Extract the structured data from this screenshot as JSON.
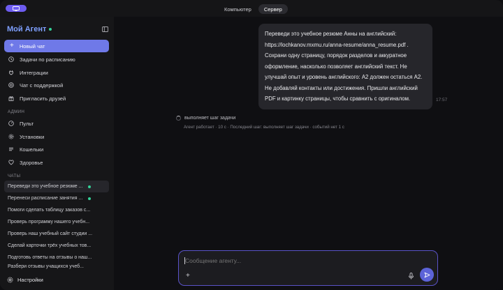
{
  "topbar": {
    "modes": [
      "Компьютер",
      "Сервер"
    ],
    "active_mode": "Сервер"
  },
  "sidebar": {
    "brand": "Мой Агент",
    "new_chat": "Новый чат",
    "nav": [
      {
        "label": "Задачи по расписанию",
        "icon": "clock-icon"
      },
      {
        "label": "Интеграции",
        "icon": "plug-icon"
      },
      {
        "label": "Чат с поддержкой",
        "icon": "support-icon"
      },
      {
        "label": "Пригласить друзей",
        "icon": "gift-icon"
      }
    ],
    "admin_label": "АДМИН",
    "admin": [
      {
        "label": "Пульт",
        "icon": "dashboard-icon"
      },
      {
        "label": "Установки",
        "icon": "gear-icon"
      },
      {
        "label": "Кошельки",
        "icon": "wallet-icon"
      },
      {
        "label": "Здоровье",
        "icon": "heart-icon"
      }
    ],
    "chats_label": "ЧАТЫ",
    "chats": [
      {
        "label": "Переведи это учебное резюме ...",
        "dot": true,
        "active": true
      },
      {
        "label": "Перенеси расписание занятия ...",
        "dot": true,
        "active": false
      },
      {
        "label": "Помоги сделать таблицу заказов с...",
        "dot": false,
        "active": false
      },
      {
        "label": "Проверь программу нашего учебн...",
        "dot": false,
        "active": false
      },
      {
        "label": "Проверь наш учебный сайт студии ...",
        "dot": false,
        "active": false
      },
      {
        "label": "Сделай карточки трёх учебных тов...",
        "dot": false,
        "active": false
      },
      {
        "label": "Подготовь ответы на отзывы о наш...",
        "dot": false,
        "active": false
      },
      {
        "label": "Разбери отзывы учащихся учеб...",
        "dot": false,
        "active": false
      }
    ],
    "settings": "Настройки"
  },
  "main": {
    "message": "Переведи это учебное резюме Анны на английский: https://lochkanov.mxmu.ru/anna-resume/anna_resume.pdf . Сохрани одну страницу, порядок разделов и аккуратное оформление, насколько позволяет английский текст. Не улучшай опыт и уровень английского: A2 должен остаться A2. Не добавляй контакты или достижения. Пришли английский PDF и картинку страницы, чтобы сравнить с оригиналом.",
    "time": "17:57",
    "status": "выполняет шаг задачи",
    "status_sub": "Агент работает · 10 с · Последний шаг: выполняет шаг задачи · событий нет 1 с",
    "composer_placeholder": "Сообщение агенту..."
  },
  "colors": {
    "accent": "#6f79e8",
    "send": "#5c63d8",
    "brand": "#7fa0ff",
    "online": "#34d399"
  }
}
